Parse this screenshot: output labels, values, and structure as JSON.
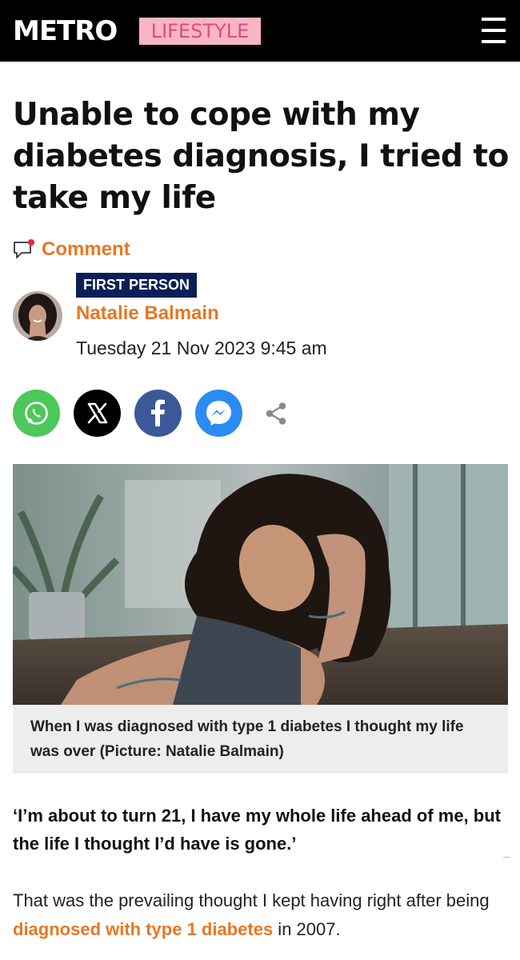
{
  "header": {
    "brand": "METRO",
    "section": "LIFESTYLE"
  },
  "article": {
    "headline": "Unable to cope with my diabetes diagnosis, I tried to take my life",
    "comment_label": "Comment",
    "category_badge": "FIRST PERSON",
    "author": "Natalie Balmain",
    "date": "Tuesday 21 Nov 2023 9:45 am",
    "image_caption": "When I was diagnosed with type 1 diabetes I thought my life was over (Picture: Natalie Balmain)",
    "lede": "‘I’m about to turn 21, I have my whole life ahead of me, but the life I thought I’d have is gone.’",
    "para_before_link": "That was the prevailing thought I kept having right after being ",
    "para_link": "diagnosed with type 1 diabetes",
    "para_after_link": " in 2007."
  },
  "share": {
    "buttons": [
      "whatsapp-icon",
      "x-icon",
      "facebook-icon",
      "messenger-icon",
      "share-icon"
    ]
  },
  "colors": {
    "accent": "#e87722",
    "badge_bg": "#0b1f57",
    "section_bg": "#f7b6c2",
    "section_text": "#e04a84",
    "whatsapp": "#4cc75a",
    "facebook": "#3b5998",
    "messenger": "#2a8cf2"
  }
}
